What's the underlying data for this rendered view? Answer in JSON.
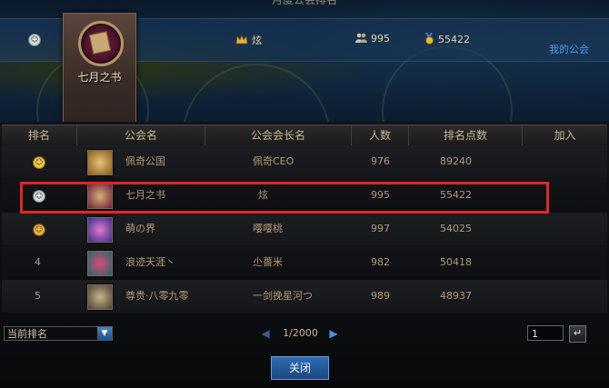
{
  "window": {
    "title": "月度公会排名"
  },
  "header": {
    "guild_name": "七月之书",
    "leader": "炫",
    "members": "995",
    "points": "55422",
    "my_guild_link": "我的公会"
  },
  "columns": [
    "排名",
    "公会名",
    "公会会长名",
    "人数",
    "排名点数",
    "加入"
  ],
  "rows": [
    {
      "rank": "",
      "badge": "gold",
      "guild": "佩奇公国",
      "leader": "佩奇CEO",
      "members": "976",
      "points": "89240",
      "icon_color": "#c8a04a"
    },
    {
      "rank": "",
      "badge": "silver",
      "guild": "七月之书",
      "leader": "炫",
      "members": "995",
      "points": "55422",
      "icon_color": "#7a2a4a"
    },
    {
      "rank": "",
      "badge": "bronze",
      "guild": "萌の界",
      "leader": "嘤嘤桃",
      "members": "997",
      "points": "54025",
      "icon_color": "#7a2a7a"
    },
    {
      "rank": "4",
      "badge": "",
      "guild": "浪迹天涯丶",
      "leader": "尐薔米",
      "members": "982",
      "points": "50418",
      "icon_color": "#2a6a7a"
    },
    {
      "rank": "5",
      "badge": "",
      "guild": "尊贵·八零九零",
      "leader": "一剑挽星河つ",
      "members": "989",
      "points": "48937",
      "icon_color": "#6a6a5a"
    }
  ],
  "footer": {
    "sort_select": "当前排名",
    "page_text": "1/2000",
    "page_input": "1",
    "go_glyph": "↵",
    "close_label": "关闭"
  }
}
